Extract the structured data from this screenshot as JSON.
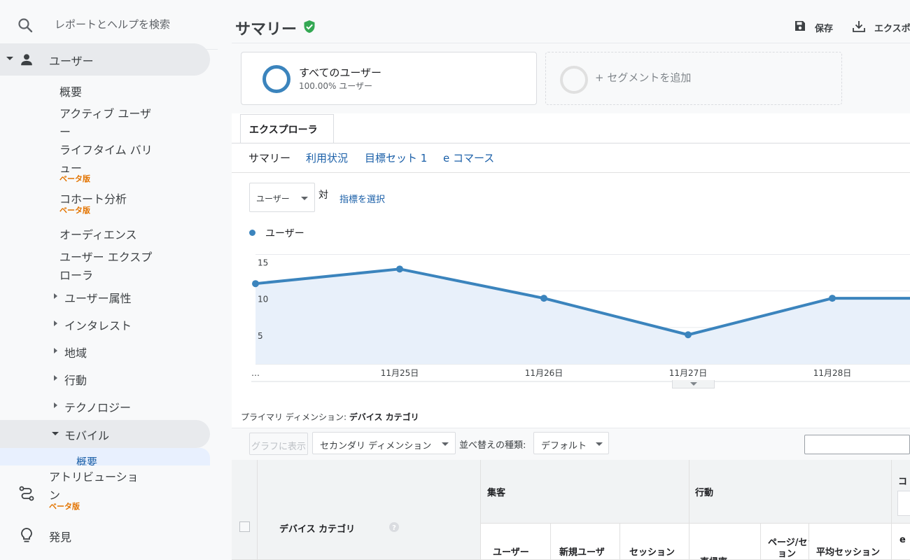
{
  "search": {
    "placeholder": "レポートとヘルプを検索"
  },
  "sidebar": {
    "users_section": {
      "label": "ユーザー"
    },
    "items": [
      {
        "label": "概要"
      },
      {
        "label": "アクティブ ユーザ",
        "label2": "ー"
      },
      {
        "label": "ライフタイム バリ",
        "label2": "ュー",
        "badge": "ベータ版"
      },
      {
        "label": "コホート分析",
        "badge": "ベータ版"
      },
      {
        "label": "オーディエンス"
      },
      {
        "label": "ユーザー エクスプ",
        "label2": "ローラ"
      },
      {
        "label": "ユーザー属性"
      },
      {
        "label": "インタレスト"
      },
      {
        "label": "地域"
      },
      {
        "label": "行動"
      },
      {
        "label": "テクノロジー"
      },
      {
        "label": "モバイル"
      },
      {
        "label": "概要"
      }
    ],
    "attribution": {
      "label": "アトリビューショ",
      "label2": "ン",
      "badge": "ベータ版"
    },
    "discover": {
      "label": "発見"
    }
  },
  "header": {
    "title": "サマリー",
    "save_label": "保存",
    "export_label": "エクスポ"
  },
  "segments": {
    "all": {
      "name": "すべてのユーザー",
      "sub": "100.00% ユーザー"
    },
    "add": {
      "label": "+ セグメントを追加"
    }
  },
  "tabs": {
    "explorer": "エクスプローラ"
  },
  "subtabs": [
    "サマリー",
    "利用状況",
    "目標セット 1",
    "e コマース"
  ],
  "metric": {
    "selected": "ユーザー",
    "vs": "対",
    "select_label": "指標を選択"
  },
  "colors": {
    "accent": "#3b84bd",
    "link": "#1a5fa8",
    "beta": "#e37400",
    "verified": "#34a853"
  },
  "chart_data": {
    "type": "area",
    "x": [
      "…",
      "11月25日",
      "11月26日",
      "11月27日",
      "11月28日",
      ""
    ],
    "series": [
      {
        "name": "ユーザー",
        "values": [
          11,
          13,
          9,
          4,
          9,
          9
        ]
      }
    ],
    "y_ticks": [
      15,
      10,
      5
    ],
    "ylim": [
      0,
      16
    ],
    "legend": "top-left",
    "grid": true
  },
  "table": {
    "primary_dimension_label": "プライマリ ディメンション:",
    "primary_dimension_value": "デバイス カテゴリ",
    "plot_button": "グラフに表示",
    "secondary_dimension": "セカンダリ ディメンション",
    "sort_label": "並べ替えの種類:",
    "sort_value": "デフォルト",
    "group_acquisition": "集客",
    "group_behavior": "行動",
    "group_conversion": "コ",
    "dimension_header": "デバイス カテゴリ",
    "col_users": "ユーザー",
    "col_new_users": "新規ユーザ",
    "col_sessions": "セッション",
    "col_bounce": "直帰率",
    "col_pages": "ページ/セッシ",
    "col_pages_b": "ョン",
    "col_avg_session": "平均セッション",
    "col_ecom": "e"
  }
}
